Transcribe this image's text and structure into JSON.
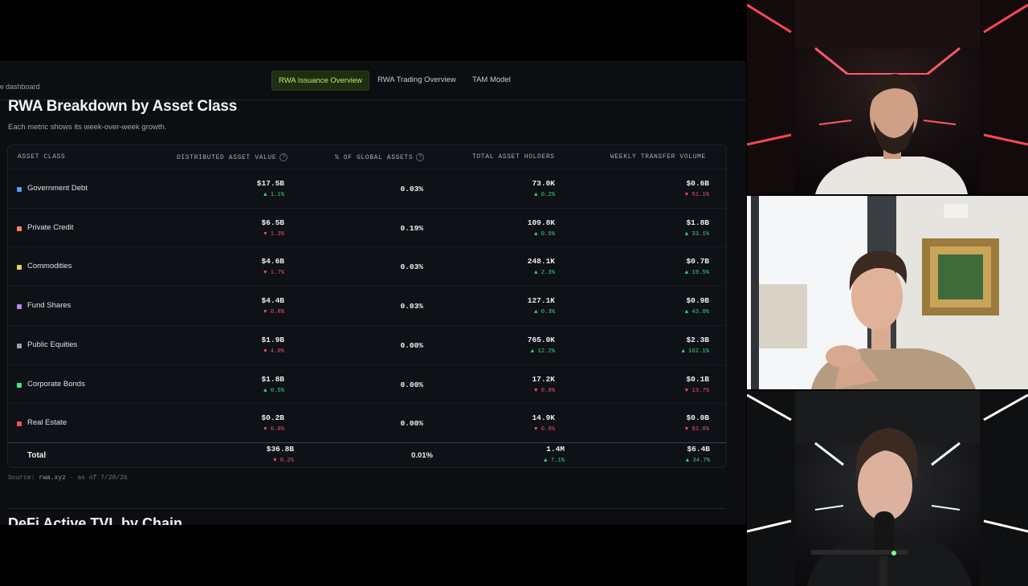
{
  "nav": {
    "back_label": "w dashboard",
    "tabs": [
      "RWA Issuance Overview",
      "RWA Trading Overview",
      "TAM Model"
    ],
    "active_tab": "RWA Issuance Overview"
  },
  "header": {
    "title": "RWA Breakdown by Asset Class",
    "subtitle": "Each metric shows its week-over-week growth."
  },
  "table": {
    "columns": [
      "ASSET CLASS",
      "DISTRIBUTED ASSET VALUE",
      "% OF GLOBAL ASSETS",
      "TOTAL ASSET HOLDERS",
      "WEEKLY TRANSFER VOLUME"
    ],
    "help_icon_glyph": "?",
    "rows": [
      {
        "name": "Government Debt",
        "color": "#5b9cf6",
        "value": "$17.5B",
        "value_chg": "▲ 1.1%",
        "value_dir": "up",
        "pct": "0.03%",
        "holders": "73.0K",
        "holders_chg": "▲ 0.2%",
        "holders_dir": "up",
        "volume": "$0.6B",
        "volume_chg": "▼ 51.1%",
        "volume_dir": "down"
      },
      {
        "name": "Private Credit",
        "color": "#f0865a",
        "value": "$6.5B",
        "value_chg": "▼ 1.3%",
        "value_dir": "down",
        "pct": "0.19%",
        "holders": "109.8K",
        "holders_chg": "▲ 0.5%",
        "holders_dir": "up",
        "volume": "$1.8B",
        "volume_chg": "▲ 33.1%",
        "volume_dir": "up"
      },
      {
        "name": "Commodities",
        "color": "#f1cc4d",
        "value": "$4.6B",
        "value_chg": "▼ 1.7%",
        "value_dir": "down",
        "pct": "0.03%",
        "holders": "248.1K",
        "holders_chg": "▲ 2.3%",
        "holders_dir": "up",
        "volume": "$0.7B",
        "volume_chg": "▲ 19.5%",
        "volume_dir": "up"
      },
      {
        "name": "Fund Shares",
        "color": "#b489f0",
        "value": "$4.4B",
        "value_chg": "▼ 0.8%",
        "value_dir": "down",
        "pct": "0.03%",
        "holders": "127.1K",
        "holders_chg": "▲ 0.3%",
        "holders_dir": "up",
        "volume": "$0.9B",
        "volume_chg": "▲ 43.0%",
        "volume_dir": "up"
      },
      {
        "name": "Public Equities",
        "color": "#9aa3ad",
        "value": "$1.9B",
        "value_chg": "▼ 4.0%",
        "value_dir": "down",
        "pct": "0.00%",
        "holders": "765.0K",
        "holders_chg": "▲ 12.2%",
        "holders_dir": "up",
        "volume": "$2.3B",
        "volume_chg": "▲ 162.1%",
        "volume_dir": "up"
      },
      {
        "name": "Corporate Bonds",
        "color": "#4ee08a",
        "value": "$1.8B",
        "value_chg": "▲ 0.5%",
        "value_dir": "up",
        "pct": "0.00%",
        "holders": "17.2K",
        "holders_chg": "▼ 0.0%",
        "holders_dir": "down",
        "volume": "$0.1B",
        "volume_chg": "▼ 13.7%",
        "volume_dir": "down"
      },
      {
        "name": "Real Estate",
        "color": "#ef4f6a",
        "value": "$0.2B",
        "value_chg": "▼ 0.0%",
        "value_dir": "down",
        "pct": "0.00%",
        "holders": "14.9K",
        "holders_chg": "▼ 0.0%",
        "holders_dir": "down",
        "volume": "$0.0B",
        "volume_chg": "▼ 82.0%",
        "volume_dir": "down"
      }
    ],
    "total": {
      "label": "Total",
      "value": "$36.8B",
      "value_chg": "▼ 0.2%",
      "value_dir": "down",
      "pct": "0.01%",
      "holders": "1.4M",
      "holders_chg": "▲ 7.1%",
      "holders_dir": "up",
      "volume": "$6.4B",
      "volume_chg": "▲ 34.7%",
      "volume_dir": "up"
    }
  },
  "footer": {
    "source_prefix": "Source:",
    "source_name": "rwa.xyz",
    "source_date": "· as of 7/28/26",
    "next_section_title": "DeFi Active TVL by Chain"
  },
  "participants": [
    {
      "tile": "video-participant-1",
      "label": "participant video: man with beard, red neon corridor"
    },
    {
      "tile": "video-participant-2",
      "label": "participant video: man in bright room with painting"
    },
    {
      "tile": "video-participant-3",
      "label": "participant video: man with microphone, white neon corridor"
    }
  ]
}
